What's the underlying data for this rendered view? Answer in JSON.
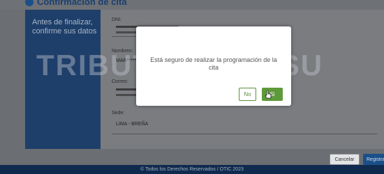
{
  "header": {
    "title": "Confirmación de cita"
  },
  "form": {
    "heading": "Antes de finalizar, confirme sus datos",
    "dni_label": "DNI:",
    "nombres_label": "Nombres:",
    "nombres_value": "MAR*****",
    "correo_label": "Correo:",
    "sede_label": "Sede:",
    "sede_value": "LIMA - BREÑA"
  },
  "watermark": "TRIBUTA Y CONSU",
  "modal": {
    "message": "Está seguro de realizar la programación de la cita",
    "no_label": "No",
    "yes_label": "Si"
  },
  "actions": {
    "cancel_label": "Cancelar",
    "register_label": "Registrar"
  },
  "footer": {
    "text": "© Todos los Derechos Reservados / OTIC 2023"
  },
  "colors": {
    "accent": "#1b4f8a",
    "success": "#5e9a3a",
    "footer_bg": "#0f2a4e"
  }
}
